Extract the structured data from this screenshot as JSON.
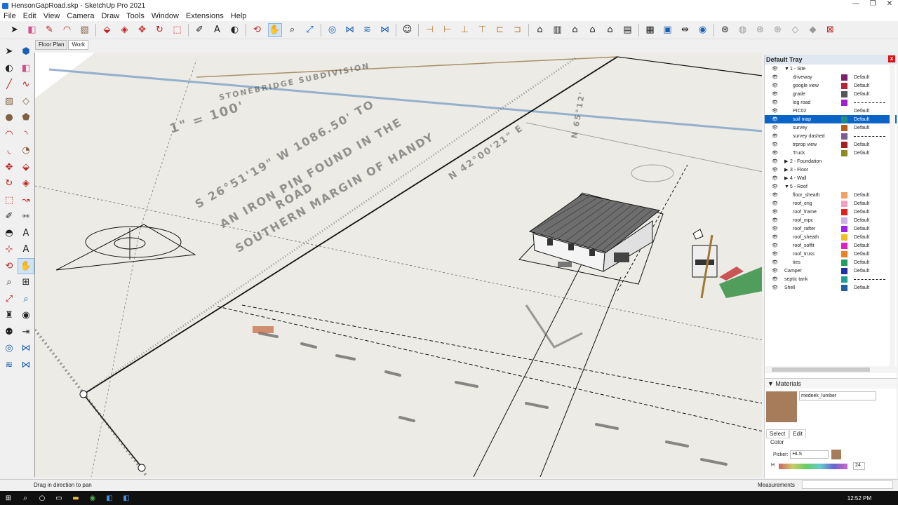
{
  "window": {
    "title": "HensonGapRoad.skp - SketchUp Pro 2021",
    "min": "—",
    "restore": "❐",
    "close": "✕"
  },
  "menu": [
    "File",
    "Edit",
    "View",
    "Camera",
    "Draw",
    "Tools",
    "Window",
    "Extensions",
    "Help"
  ],
  "scenes": [
    {
      "label": "Floor Plan"
    },
    {
      "label": "Work"
    }
  ],
  "viewport": {
    "drawing_text": {
      "line1": "STONEBRIDGE SUBDIVISION",
      "line2": "1\" = 100'",
      "line3": "S 26°51'19\" W 1086.50' TO",
      "line4": "AN IRON PIN FOUND IN THE",
      "line5": "SOUTHERN MARGIN OF HANDY",
      "line6": "ROAD",
      "line7": "N 42°00'21\" E",
      "line8": "N 65°12'"
    }
  },
  "tray": {
    "title": "Default Tray",
    "close": "x",
    "tags": [
      {
        "name": "1 - Site",
        "arrow": "▼",
        "level": 1,
        "swatch": "",
        "value": ""
      },
      {
        "name": "driveway",
        "level": 2,
        "swatch": "#7a1f6e",
        "value": "Default"
      },
      {
        "name": "google view",
        "level": 2,
        "swatch": "#b3263a",
        "value": "Default"
      },
      {
        "name": "grade",
        "level": 2,
        "swatch": "#555555",
        "value": "Default"
      },
      {
        "name": "log road",
        "level": 2,
        "swatch": "#a020d0",
        "value": "",
        "dashed": true
      },
      {
        "name": "PIC02",
        "level": 2,
        "swatch": "",
        "value": "Default"
      },
      {
        "name": "soil map",
        "level": 2,
        "swatch": "#1f8f85",
        "value": "Default",
        "selected": true
      },
      {
        "name": "survey",
        "level": 2,
        "swatch": "#b85c1a",
        "value": "Default"
      },
      {
        "name": "survey dashed",
        "level": 2,
        "swatch": "#7a5e8f",
        "value": "",
        "dashed": true
      },
      {
        "name": "trprop view",
        "level": 2,
        "swatch": "#a32020",
        "value": "Default"
      },
      {
        "name": "Truck",
        "level": 2,
        "swatch": "#8a8a20",
        "value": "Default"
      },
      {
        "name": "2 - Foundation",
        "arrow": "▶",
        "level": 1,
        "swatch": "",
        "value": ""
      },
      {
        "name": "3 - Floor",
        "arrow": "▶",
        "level": 1,
        "swatch": "",
        "value": ""
      },
      {
        "name": "4 - Wall",
        "arrow": "▶",
        "level": 1,
        "swatch": "",
        "value": ""
      },
      {
        "name": "5 - Roof",
        "arrow": "▼",
        "level": 1,
        "swatch": "",
        "value": ""
      },
      {
        "name": "floor_sheath",
        "level": 2,
        "swatch": "#f0a060",
        "value": "Default"
      },
      {
        "name": "roof_eng",
        "level": 2,
        "swatch": "#f0a0c0",
        "value": "Default"
      },
      {
        "name": "roof_frame",
        "level": 2,
        "swatch": "#e02020",
        "value": "Default"
      },
      {
        "name": "roof_mpc",
        "level": 2,
        "swatch": "#d0b0e8",
        "value": "Default"
      },
      {
        "name": "roof_rafter",
        "level": 2,
        "swatch": "#a020f0",
        "value": "Default"
      },
      {
        "name": "roof_sheath",
        "level": 2,
        "swatch": "#f0c020",
        "value": "Default"
      },
      {
        "name": "roof_soffit",
        "level": 2,
        "swatch": "#e020c0",
        "value": "Default"
      },
      {
        "name": "roof_truss",
        "level": 2,
        "swatch": "#f08020",
        "value": "Default"
      },
      {
        "name": "ties",
        "level": 2,
        "swatch": "#20a060",
        "value": "Default"
      },
      {
        "name": "Camper",
        "level": 0,
        "swatch": "#2030a0",
        "value": "Default"
      },
      {
        "name": "septic tank",
        "level": 0,
        "swatch": "#20a090",
        "value": "",
        "dashed": true
      },
      {
        "name": "Shell",
        "level": 0,
        "swatch": "#2060a0",
        "value": "Default"
      }
    ]
  },
  "materials": {
    "title": "Materials",
    "name": "medeek_lumber",
    "swatch_color": "#a67c5b",
    "tab_select": "Select",
    "tab_edit": "Edit",
    "color_label": "Color",
    "picker_label": "Picker:",
    "picker_value": "HLS",
    "h_label": "H",
    "h_value": "24"
  },
  "status": {
    "message": "Drag in direction to pan",
    "measurements": "Measurements"
  },
  "taskbar": {
    "time": "12:52 PM"
  }
}
